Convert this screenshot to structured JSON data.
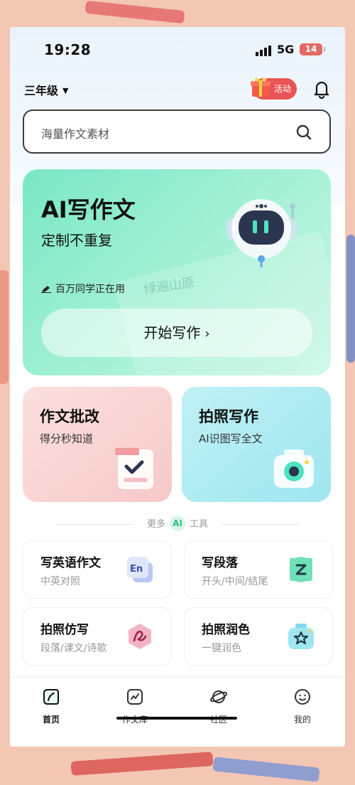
{
  "status_bar": {
    "time": "19:28",
    "network": "5G",
    "battery": "14"
  },
  "header": {
    "grade": "三年级",
    "activity_label": "活动"
  },
  "search": {
    "placeholder": "海量作文素材"
  },
  "hero": {
    "title": "AI写作文",
    "subtitle": "定制不重复",
    "users_text": "百万同学正在用",
    "stamp_text": "绿遍山原",
    "button_label": "开始写作",
    "button_arrow": "›"
  },
  "cards": [
    {
      "title": "作文批改",
      "subtitle": "得分秒知道"
    },
    {
      "title": "拍照写作",
      "subtitle": "AI识图写全文"
    }
  ],
  "more_tools": {
    "left": "更多",
    "badge": "AI",
    "right": "工具"
  },
  "tools": [
    {
      "title": "写英语作文",
      "subtitle": "中英对照",
      "icon": "english-icon"
    },
    {
      "title": "写段落",
      "subtitle": "开头/中间/结尾",
      "icon": "paragraph-icon"
    },
    {
      "title": "拍照仿写",
      "subtitle": "段落/课文/诗歌",
      "icon": "imitate-icon"
    },
    {
      "title": "拍照润色",
      "subtitle": "一键润色",
      "icon": "polish-icon"
    }
  ],
  "tabbar": [
    {
      "label": "首页",
      "icon": "home-icon",
      "active": true
    },
    {
      "label": "作文库",
      "icon": "library-icon",
      "active": false
    },
    {
      "label": "社区",
      "icon": "community-icon",
      "active": false
    },
    {
      "label": "我的",
      "icon": "profile-icon",
      "active": false
    }
  ],
  "colors": {
    "hero_green": "#79e7c5",
    "card_pink": "#f6c9c8",
    "card_cyan": "#9fe6ef",
    "activity_red": "#e95454",
    "background_peach": "#f4c6b4"
  }
}
